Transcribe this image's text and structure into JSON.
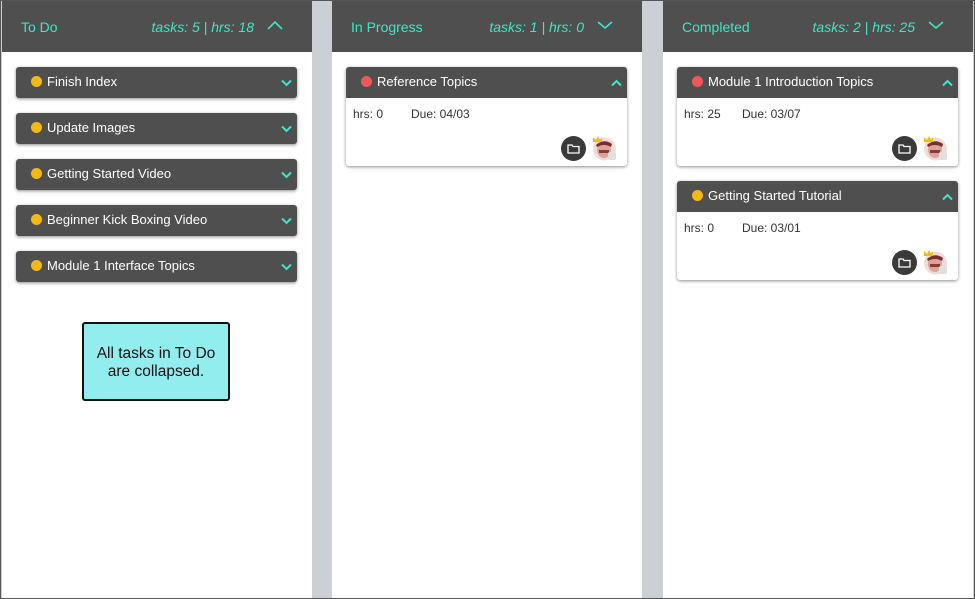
{
  "columns": {
    "todo": {
      "title": "To Do",
      "stats": "tasks: 5 | hrs: 18",
      "chevron": "chevron-up-icon",
      "tasks": [
        {
          "title": "Finish Index",
          "status_color": "#f5b914"
        },
        {
          "title": "Update Images",
          "status_color": "#f5b914"
        },
        {
          "title": "Getting Started Video",
          "status_color": "#f5b914"
        },
        {
          "title": "Beginner Kick Boxing Video",
          "status_color": "#f5b914"
        },
        {
          "title": "Module 1 Interface Topics",
          "status_color": "#f5b914"
        }
      ]
    },
    "in_progress": {
      "title": "In Progress",
      "stats": "tasks: 1 | hrs: 0",
      "chevron": "chevron-down-icon",
      "tasks": [
        {
          "title": "Reference Topics",
          "status_color": "#f25757",
          "hrs": "hrs: 0",
          "due": "Due: 04/03"
        }
      ]
    },
    "completed": {
      "title": "Completed",
      "stats": "tasks: 2 | hrs: 25",
      "chevron": "chevron-down-icon",
      "tasks": [
        {
          "title": "Module 1 Introduction Topics",
          "status_color": "#f25757",
          "hrs": "hrs: 25",
          "due": "Due: 03/07"
        },
        {
          "title": "Getting Started Tutorial",
          "status_color": "#f5b914",
          "hrs": "hrs: 0",
          "due": "Due: 03/01"
        }
      ]
    }
  },
  "note": {
    "line1": "All tasks in To Do",
    "line2": "are collapsed."
  },
  "colors": {
    "header_bg": "#4f4f4f",
    "accent": "#3ee6c8",
    "note_bg": "#92eeee",
    "board_bg": "#ccd0d4"
  }
}
